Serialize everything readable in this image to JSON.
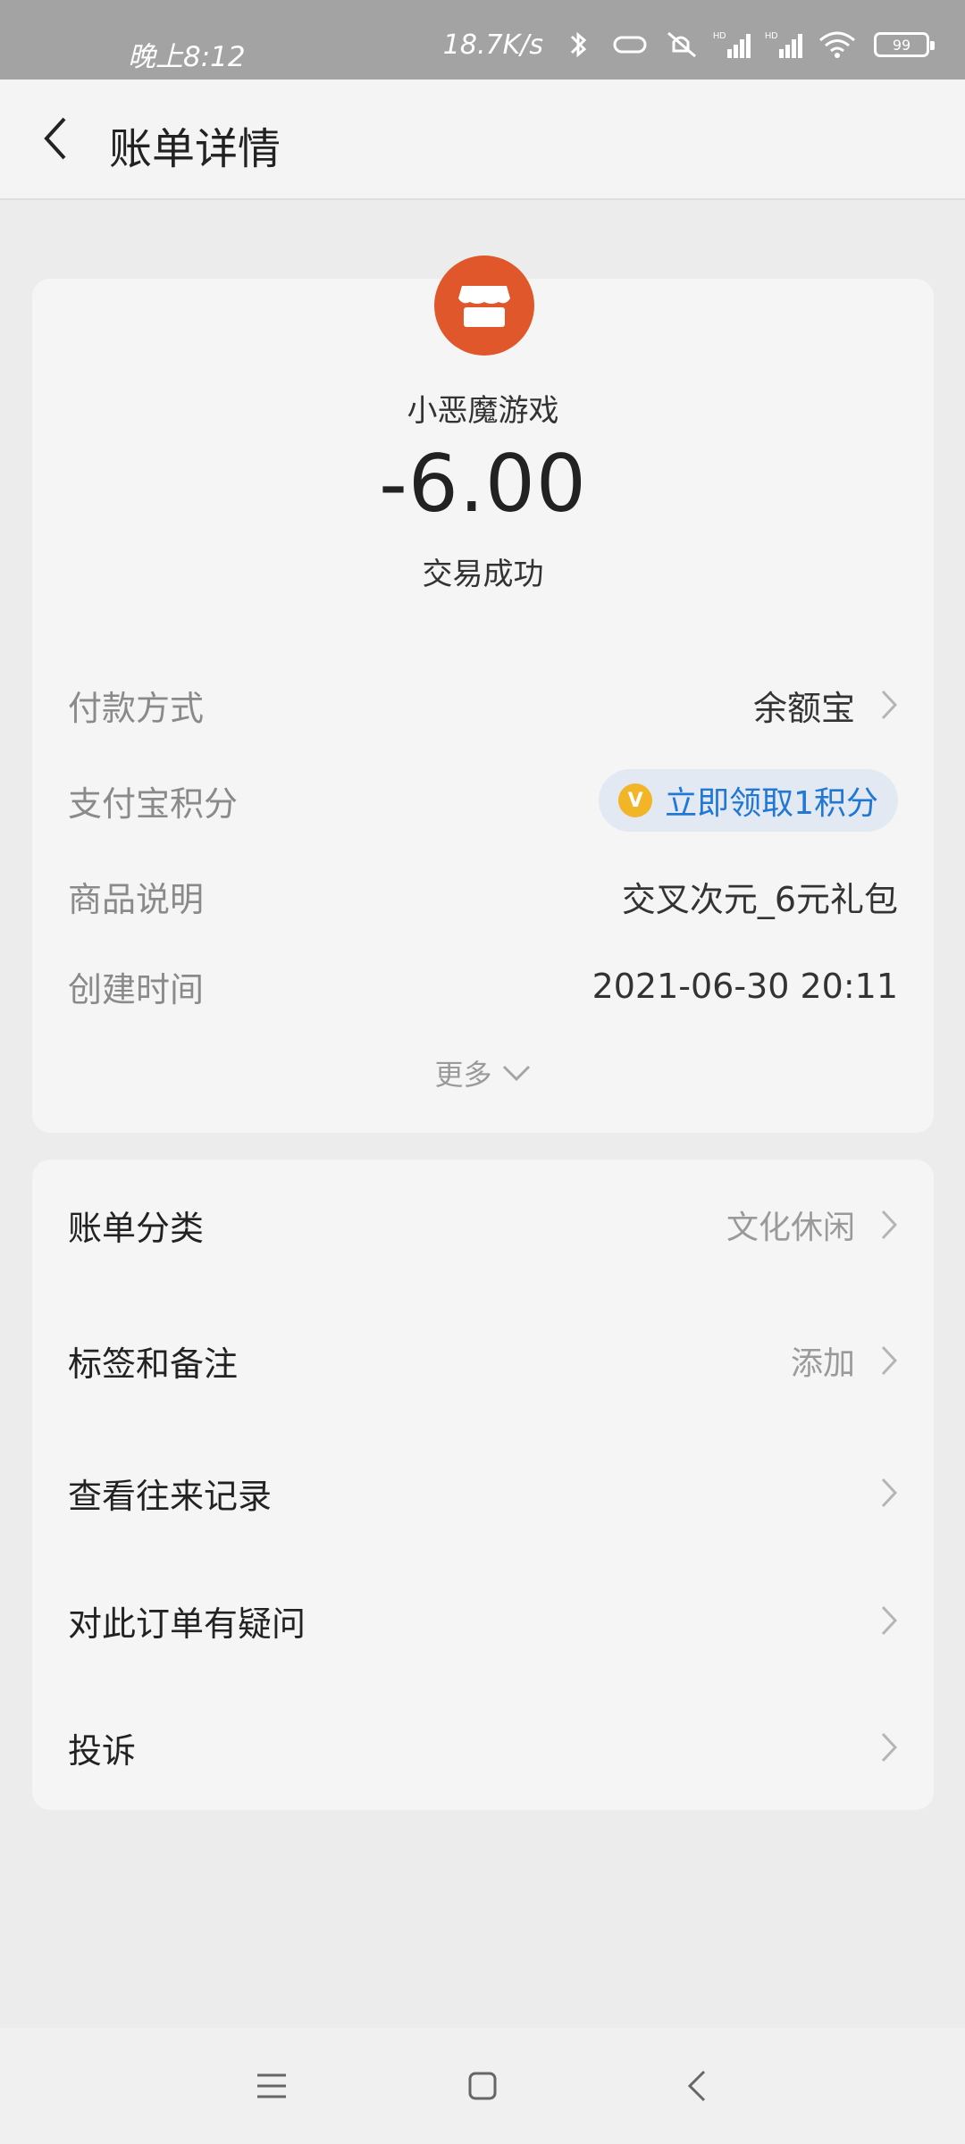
{
  "status_bar": {
    "time": "晚上8:12",
    "speed": "18.7K/s",
    "battery": "99"
  },
  "header": {
    "title": "账单详情"
  },
  "summary": {
    "merchant": "小恶魔游戏",
    "amount": "-6.00",
    "status": "交易成功",
    "logo_color": "#e0572b"
  },
  "details": [
    {
      "label": "付款方式",
      "value": "余额宝"
    },
    {
      "label": "支付宝积分",
      "value": "立即领取1积分"
    },
    {
      "label": "商品说明",
      "value": "交叉次元_6元礼包"
    },
    {
      "label": "创建时间",
      "value": "2021-06-30 20:11"
    }
  ],
  "more_label": "更多",
  "actions": [
    {
      "label": "账单分类",
      "value": "文化休闲"
    },
    {
      "label": "标签和备注",
      "value": "添加"
    },
    {
      "label": "查看往来记录",
      "value": ""
    },
    {
      "label": "对此订单有疑问",
      "value": ""
    },
    {
      "label": "投诉",
      "value": ""
    }
  ],
  "colors": {
    "accent_blue": "#2177d6",
    "coin_gold": "#f1b527"
  }
}
